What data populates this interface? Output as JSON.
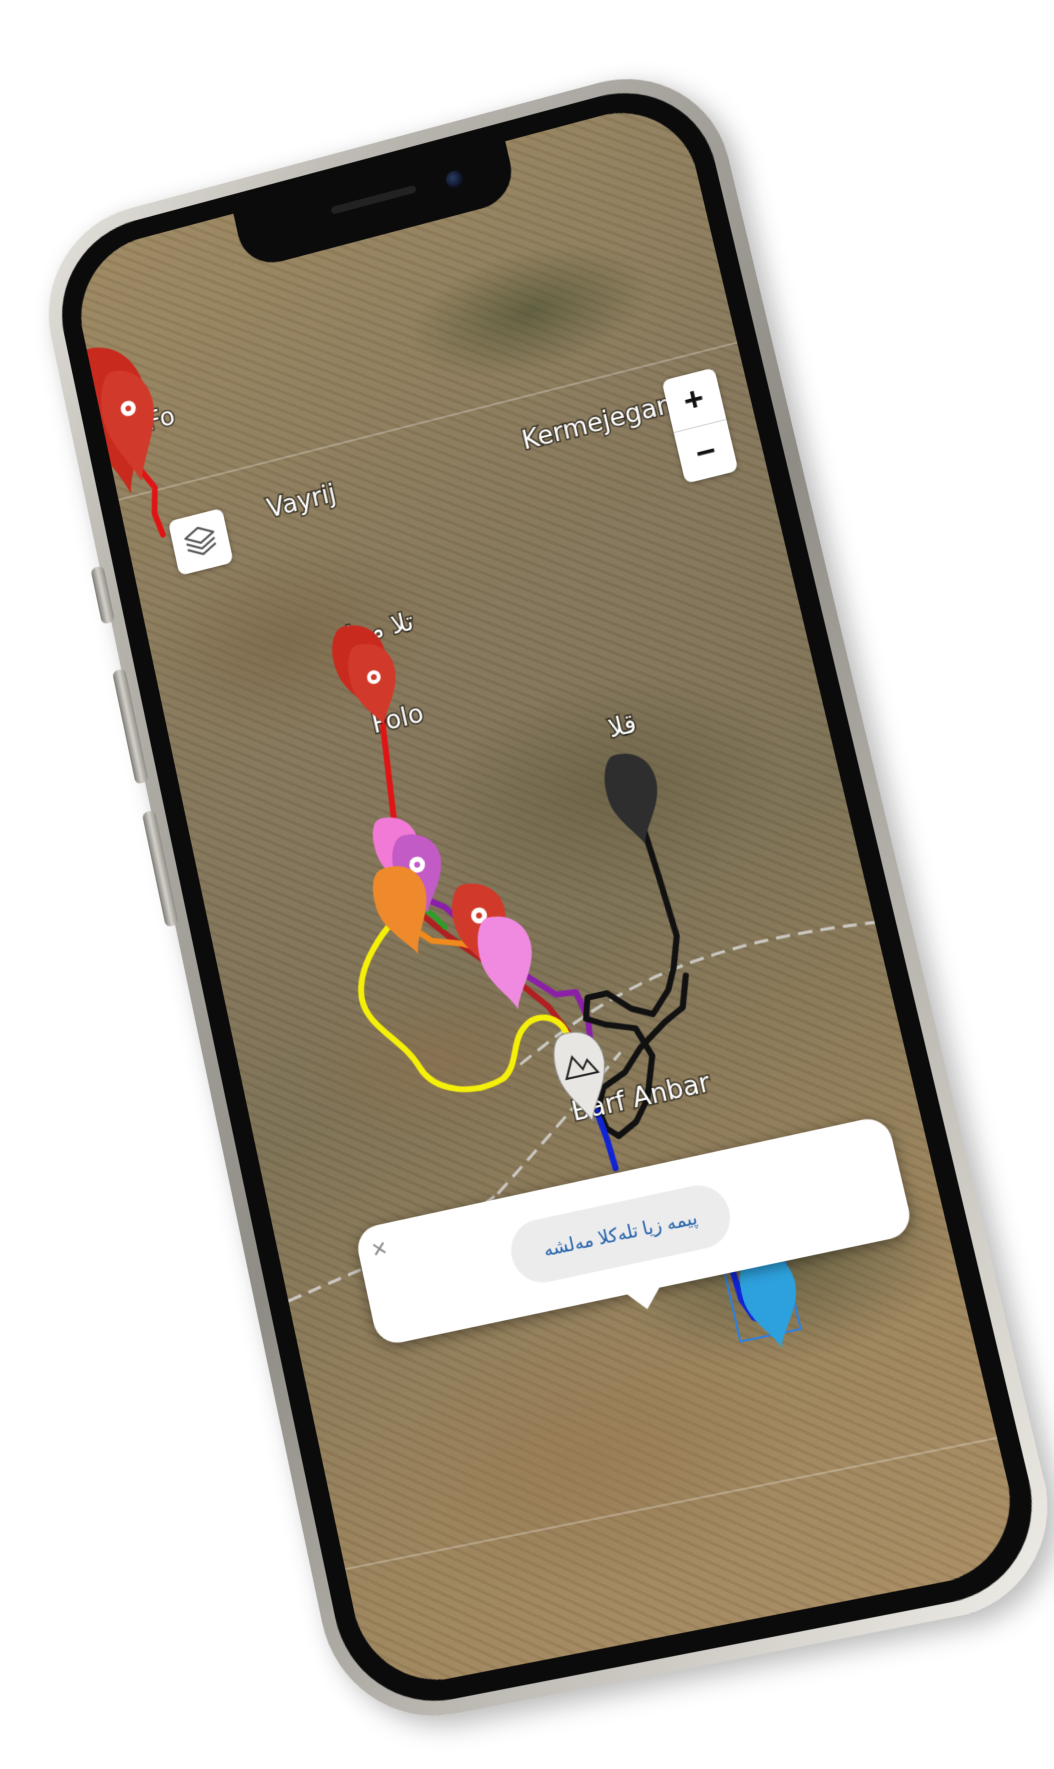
{
  "map": {
    "labels": {
      "vayrij": "Vayrij",
      "kermejegan": "Kermejegan",
      "fowlo_top": "Fo",
      "fowlo_mid": "Folo",
      "tala_mahal": "تلا محل",
      "qalla": "قلا",
      "barf_anbar": "Barf Anbar"
    },
    "controls": {
      "zoom_in": "+",
      "zoom_out": "−",
      "layers_icon": "layers-icon"
    },
    "route_colors": {
      "red": "#e01414",
      "yellow": "#f5f00a",
      "black": "#111111",
      "purple": "#8b1fa8",
      "orange": "#f08a1c",
      "dark_red": "#b02020",
      "blue": "#1024d6",
      "green": "#2aa028"
    },
    "marker_colors": {
      "red": "#d13a2a",
      "pink": "#f07ad6",
      "magenta": "#c25bc6",
      "orange": "#ef8a2c",
      "dark": "#2e2e2e",
      "cyan": "#2da1dd",
      "mountain": "#e8e6e2"
    }
  },
  "popup": {
    "close": "×",
    "text": "پیمە زیا تلەکلا مەلشە"
  }
}
